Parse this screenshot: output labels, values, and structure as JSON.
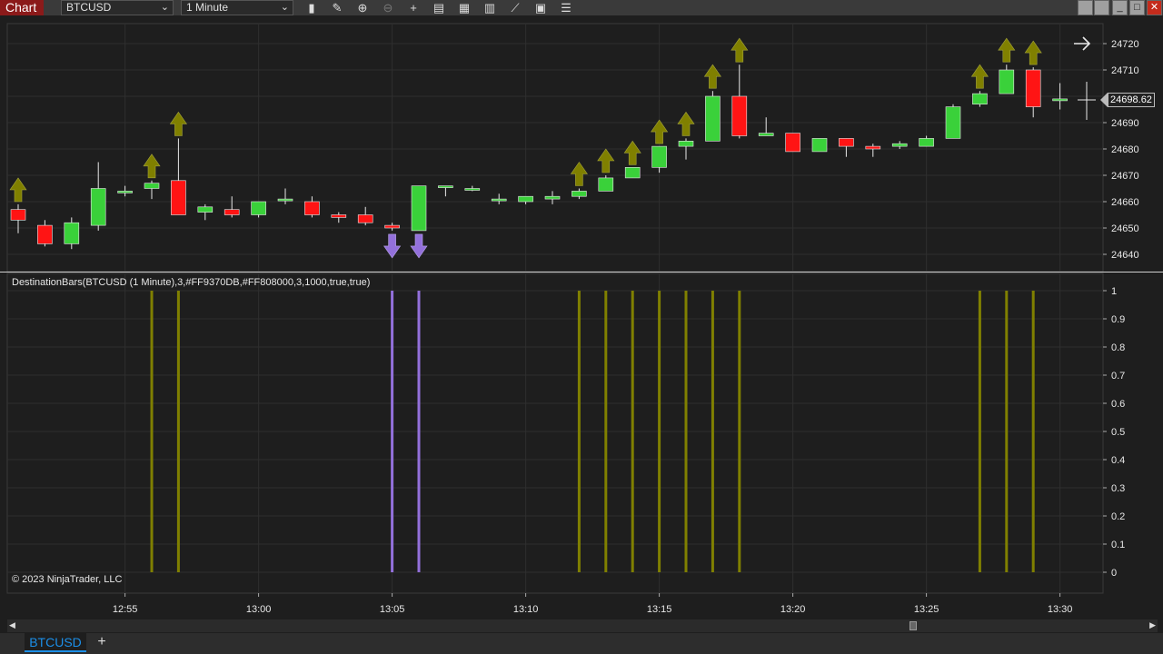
{
  "toolbar": {
    "label": "Chart",
    "instrument": "BTCUSD",
    "interval": "1 Minute",
    "icons": [
      "bar-type-icon",
      "draw-pencil-icon",
      "zoom-in-icon",
      "zoom-out-icon",
      "crosshair-icon",
      "data-box-icon",
      "templates-icon",
      "indicators-icon",
      "strategies-icon",
      "properties-icon",
      "list-icon"
    ]
  },
  "price_axis": {
    "current_price": "24698.62"
  },
  "indicator": {
    "title": "DestinationBars(BTCUSD (1 Minute),3,#FF9370DB,#FF808000,3,1000,true,true)"
  },
  "copyright": "© 2023 NinjaTrader, LLC",
  "tabs": {
    "active": "BTCUSD",
    "add": "+"
  },
  "colors": {
    "up_candle": "#3ad13a",
    "down_candle": "#ff1414",
    "up_arrow": "#808000",
    "down_arrow": "#9370db",
    "background": "#1e1e1e",
    "grid": "#2e2e2e"
  },
  "chart_data": [
    {
      "type": "candlestick",
      "y_ticks": [
        24640,
        24650,
        24660,
        24670,
        24680,
        24690,
        24710,
        24720
      ],
      "ylim": [
        24636,
        24726
      ],
      "x_ticks": [
        "12:55",
        "13:00",
        "13:05",
        "13:10",
        "13:15",
        "13:20",
        "13:25",
        "13:30"
      ],
      "candles": [
        {
          "o": 24657,
          "h": 24659,
          "l": 24648,
          "c": 24653
        },
        {
          "o": 24651,
          "h": 24653,
          "l": 24643,
          "c": 24644
        },
        {
          "o": 24644,
          "h": 24654,
          "l": 24642,
          "c": 24652
        },
        {
          "o": 24651,
          "h": 24675,
          "l": 24649,
          "c": 24665
        },
        {
          "o": 24664,
          "h": 24666,
          "l": 24662,
          "c": 24664
        },
        {
          "o": 24665,
          "h": 24668,
          "l": 24661,
          "c": 24667
        },
        {
          "o": 24668,
          "h": 24684,
          "l": 24655,
          "c": 24655
        },
        {
          "o": 24656,
          "h": 24659,
          "l": 24653,
          "c": 24658
        },
        {
          "o": 24657,
          "h": 24662,
          "l": 24654,
          "c": 24655
        },
        {
          "o": 24655,
          "h": 24660,
          "l": 24654,
          "c": 24660
        },
        {
          "o": 24661,
          "h": 24665,
          "l": 24659,
          "c": 24661
        },
        {
          "o": 24660,
          "h": 24662,
          "l": 24654,
          "c": 24655
        },
        {
          "o": 24655,
          "h": 24656,
          "l": 24652,
          "c": 24654
        },
        {
          "o": 24655,
          "h": 24658,
          "l": 24651,
          "c": 24652
        },
        {
          "o": 24651,
          "h": 24652,
          "l": 24649,
          "c": 24650
        },
        {
          "o": 24649,
          "h": 24666,
          "l": 24649,
          "c": 24666
        },
        {
          "o": 24666,
          "h": 24666,
          "l": 24662,
          "c": 24666
        },
        {
          "o": 24665,
          "h": 24666,
          "l": 24664,
          "c": 24665
        },
        {
          "o": 24661,
          "h": 24663,
          "l": 24659,
          "c": 24661
        },
        {
          "o": 24660,
          "h": 24662,
          "l": 24659,
          "c": 24662
        },
        {
          "o": 24661,
          "h": 24664,
          "l": 24659,
          "c": 24662
        },
        {
          "o": 24662,
          "h": 24665,
          "l": 24661,
          "c": 24664
        },
        {
          "o": 24664,
          "h": 24670,
          "l": 24664,
          "c": 24669
        },
        {
          "o": 24669,
          "h": 24673,
          "l": 24669,
          "c": 24673
        },
        {
          "o": 24673,
          "h": 24681,
          "l": 24671,
          "c": 24681
        },
        {
          "o": 24681,
          "h": 24684,
          "l": 24676,
          "c": 24683
        },
        {
          "o": 24683,
          "h": 24702,
          "l": 24683,
          "c": 24700
        },
        {
          "o": 24700,
          "h": 24712,
          "l": 24684,
          "c": 24685
        },
        {
          "o": 24685,
          "h": 24692,
          "l": 24685,
          "c": 24686
        },
        {
          "o": 24686,
          "h": 24686,
          "l": 24679,
          "c": 24679
        },
        {
          "o": 24679,
          "h": 24684,
          "l": 24679,
          "c": 24684
        },
        {
          "o": 24684,
          "h": 24684,
          "l": 24677,
          "c": 24681
        },
        {
          "o": 24681,
          "h": 24682,
          "l": 24677,
          "c": 24680
        },
        {
          "o": 24681,
          "h": 24683,
          "l": 24680,
          "c": 24682
        },
        {
          "o": 24681,
          "h": 24685,
          "l": 24681,
          "c": 24684
        },
        {
          "o": 24684,
          "h": 24697,
          "l": 24684,
          "c": 24696
        },
        {
          "o": 24697,
          "h": 24702,
          "l": 24696,
          "c": 24701
        },
        {
          "o": 24701,
          "h": 24712,
          "l": 24701,
          "c": 24710
        },
        {
          "o": 24710,
          "h": 24711,
          "l": 24692,
          "c": 24696
        },
        {
          "o": 24699,
          "h": 24705,
          "l": 24695,
          "c": 24699
        }
      ],
      "up_arrows_at_bar": [
        0,
        5,
        6,
        21,
        22,
        23,
        24,
        25,
        26,
        27,
        36,
        37,
        38
      ],
      "down_arrows_at_bar": [
        14,
        15
      ]
    },
    {
      "type": "bar",
      "title": "DestinationBars(BTCUSD (1 Minute),3,#FF9370DB,#FF808000,3,1000,true,true)",
      "y_ticks": [
        "1",
        "0.9",
        "0.8",
        "0.7",
        "0.6",
        "0.5",
        "0.4",
        "0.3",
        "0.2",
        "0.1",
        "0"
      ],
      "ylim": [
        0,
        1
      ],
      "series": [
        {
          "color": "#808000",
          "at_bar": [
            5,
            6,
            21,
            22,
            23,
            24,
            25,
            26,
            27,
            36,
            37,
            38
          ],
          "value": 1
        },
        {
          "color": "#9370db",
          "at_bar": [
            14,
            15
          ],
          "value": 1
        }
      ]
    }
  ]
}
